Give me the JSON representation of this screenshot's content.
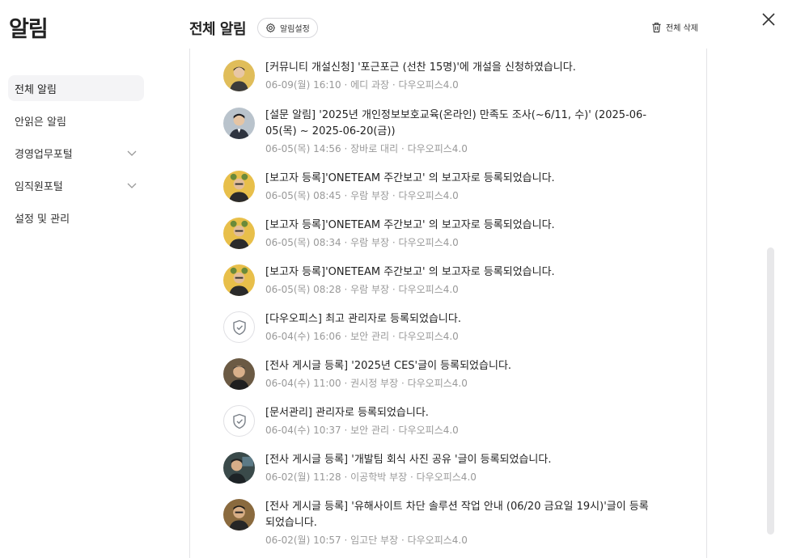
{
  "app": {
    "title": "알림"
  },
  "sidebar": {
    "items": [
      {
        "label": "전체 알림",
        "active": true,
        "has_chevron": false
      },
      {
        "label": "안읽은 알림",
        "active": false,
        "has_chevron": false
      },
      {
        "label": "경영업무포털",
        "active": false,
        "has_chevron": true
      },
      {
        "label": "임직원포털",
        "active": false,
        "has_chevron": true
      },
      {
        "label": "설정 및 관리",
        "active": false,
        "has_chevron": false
      }
    ]
  },
  "header": {
    "title": "전체 알림",
    "settings_label": "알림설정",
    "delete_all_label": "전체 삭제"
  },
  "notifications": [
    {
      "text": "[커뮤니티 개설신청] '포근포근 (선찬 15명)'에 개설을 신청하였습니다.",
      "meta": "06-09(월) 16:10 · 에디 과장 · 다우오피스4.0",
      "avatar": "person-avatar"
    },
    {
      "text": "[설문 알림] '2025년 개인정보보호교육(온라인) 만족도 조사(~6/11, 수)' (2025-06-05(목) ~ 2025-06-20(금))",
      "meta": "06-05(목) 14:56 · 장바로 대리 · 다우오피스4.0",
      "avatar": "person-avatar"
    },
    {
      "text": "[보고자 등록]'ONETEAM 주간보고' 의 보고자로 등록되었습니다.",
      "meta": "06-05(목) 08:45 · 우람 부장 · 다우오피스4.0",
      "avatar": "person-avatar"
    },
    {
      "text": "[보고자 등록]'ONETEAM 주간보고' 의 보고자로 등록되었습니다.",
      "meta": "06-05(목) 08:34 · 우람 부장 · 다우오피스4.0",
      "avatar": "person-avatar"
    },
    {
      "text": "[보고자 등록]'ONETEAM 주간보고' 의 보고자로 등록되었습니다.",
      "meta": "06-05(목) 08:28 · 우람 부장 · 다우오피스4.0",
      "avatar": "person-avatar"
    },
    {
      "text": "[다우오피스] 최고 관리자로 등록되었습니다.",
      "meta": "06-04(수) 16:06 · 보안 관리 · 다우오피스4.0",
      "avatar": "shield-icon"
    },
    {
      "text": "[전사 게시글 등록] '2025년 CES'글이 등록되었습니다.",
      "meta": "06-04(수) 11:00 · 권시정 부장 · 다우오피스4.0",
      "avatar": "person-avatar"
    },
    {
      "text": "[문서관리] 관리자로 등록되었습니다.",
      "meta": "06-04(수) 10:37 · 보안 관리 · 다우오피스4.0",
      "avatar": "shield-icon"
    },
    {
      "text": "[전사 게시글 등록] '개발팀 회식 사진 공유 '글이 등록되었습니다.",
      "meta": "06-02(월) 11:28 · 이공학박 부장 · 다우오피스4.0",
      "avatar": "person-avatar"
    },
    {
      "text": "[전사 게시글 등록] '유해사이트 차단 솔루션 작업 안내 (06/20 금요일 19시)'글이 등록되었습니다.",
      "meta": "06-02(월) 10:57 · 임고단 부장 · 다우오피스4.0",
      "avatar": "person-avatar"
    }
  ],
  "colors": {
    "active_bg": "#f4f4f6",
    "meta_text": "#999999",
    "border": "#e3e3e6"
  }
}
